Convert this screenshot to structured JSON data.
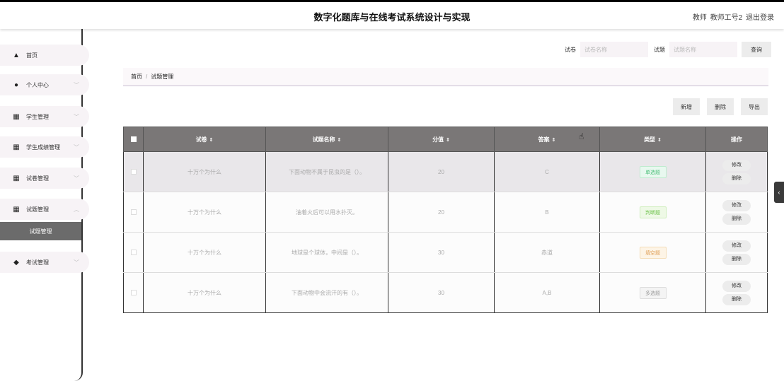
{
  "header": {
    "title": "数字化题库与在线考试系统设计与实现",
    "role": "教师",
    "username": "教师工号2",
    "logout": "退出登录"
  },
  "sidebar": {
    "items": [
      {
        "label": "首页",
        "icon": "home-icon",
        "has_arrow": false,
        "arrow": ""
      },
      {
        "label": "个人中心",
        "icon": "user-icon",
        "has_arrow": true,
        "arrow": "﹀"
      },
      {
        "label": "学生管理",
        "icon": "grid-icon",
        "has_arrow": true,
        "arrow": "﹀"
      },
      {
        "label": "学生成绩管理",
        "icon": "grid-icon",
        "has_arrow": true,
        "arrow": "﹀"
      },
      {
        "label": "试卷管理",
        "icon": "grid-icon",
        "has_arrow": true,
        "arrow": "﹀"
      },
      {
        "label": "试题管理",
        "icon": "grid-icon",
        "has_arrow": true,
        "arrow": "︿"
      },
      {
        "label": "考试管理",
        "icon": "pin-icon",
        "has_arrow": true,
        "arrow": "﹀"
      }
    ],
    "active_sub": "试题管理"
  },
  "search": {
    "paper_label": "试卷",
    "paper_placeholder": "试卷名称",
    "question_label": "试题",
    "question_placeholder": "试题名称",
    "button": "查询"
  },
  "breadcrumb": {
    "home": "首页",
    "sep": "/",
    "current": "试题管理"
  },
  "actions": {
    "add": "新增",
    "delete": "删除",
    "export": "导出"
  },
  "table": {
    "columns": [
      "试卷",
      "试题名称",
      "分值",
      "答案",
      "类型",
      "操作"
    ],
    "sort_glyph": "⇕",
    "rows": [
      {
        "paper": "十万个为什么",
        "question": "下面动物不属于昆虫的是（）。",
        "score": "20",
        "answer": "C",
        "type": "单选题"
      },
      {
        "paper": "十万个为什么",
        "question": "油着火后可以用水扑灭。",
        "score": "20",
        "answer": "B",
        "type": "判断题"
      },
      {
        "paper": "十万个为什么",
        "question": "地球是个球体，中间是（）。",
        "score": "30",
        "answer": "赤道",
        "type": "填空题"
      },
      {
        "paper": "十万个为什么",
        "question": "下面动物中会流汗的有（）。",
        "score": "30",
        "answer": "A,B",
        "type": "多选题"
      }
    ],
    "edit_label": "修改",
    "delete_label": "删除"
  },
  "colors": {
    "single_choice": {
      "bg": "#e8f8ef",
      "fg": "#4cbf7a",
      "border": "#bfeccf"
    },
    "true_false": {
      "bg": "#eef9e6",
      "fg": "#6cc24a",
      "border": "#cfeebd"
    },
    "fill_blank": {
      "bg": "#fdf4e6",
      "fg": "#e0a15a",
      "border": "#f4ddb8"
    },
    "multi_choice": {
      "bg": "#f4f4f4",
      "fg": "#999999",
      "border": "#dddddd"
    }
  },
  "side_tab": "‹"
}
